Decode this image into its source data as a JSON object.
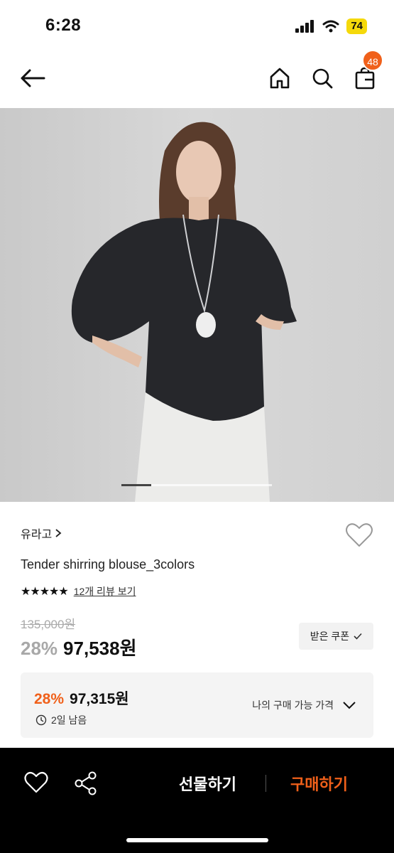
{
  "status_bar": {
    "time": "6:28",
    "battery": "74"
  },
  "nav": {
    "cart_count": "48"
  },
  "product": {
    "brand": "유라고",
    "name": "Tender shirring blouse_3colors",
    "rating_stars": "★★★★★",
    "review_link": "12개 리뷰 보기",
    "original_price": "135,000원",
    "discount_rate": "28%",
    "sale_price": "97,538원",
    "coupon_label": "받은 쿠폰",
    "carousel": {
      "current": 1,
      "total": 5
    }
  },
  "best_price": {
    "rate": "28%",
    "price": "97,315원",
    "time_left": "2일 남음",
    "label": "나의 구매 가능 가격"
  },
  "bottom_bar": {
    "gift_label": "선물하기",
    "buy_label": "구매하기"
  },
  "colors": {
    "accent": "#f0601a",
    "bottom_bar": "#000000",
    "battery": "#f5d90a"
  }
}
